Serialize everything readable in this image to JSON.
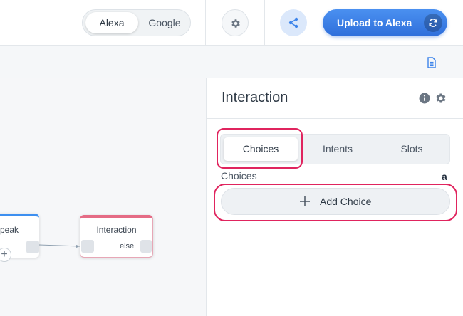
{
  "topbar": {
    "platform_toggle": {
      "alexa_label": "Alexa",
      "google_label": "Google",
      "selected": "Alexa"
    },
    "settings_icon": "gear-icon",
    "share_icon": "share-icon",
    "upload_label": "Upload to Alexa",
    "sync_icon": "sync-icon"
  },
  "subbar": {
    "document_icon": "document-icon"
  },
  "canvas": {
    "speak_node_label": "peak",
    "interaction_node": {
      "title": "Interaction",
      "else_label": "else"
    },
    "add_icon": "+"
  },
  "panel": {
    "title": "Interaction",
    "tabs": [
      {
        "label": "Choices",
        "active": true
      },
      {
        "label": "Intents",
        "active": false
      },
      {
        "label": "Slots",
        "active": false
      }
    ],
    "section_label": "Choices",
    "amazon_glyph": "a",
    "add_choice_label": "Add Choice"
  },
  "colors": {
    "accent": "#2f6fdb",
    "highlight": "#e0245e",
    "speak_node": "#3d8ff0",
    "interaction_node": "#e56c86"
  }
}
